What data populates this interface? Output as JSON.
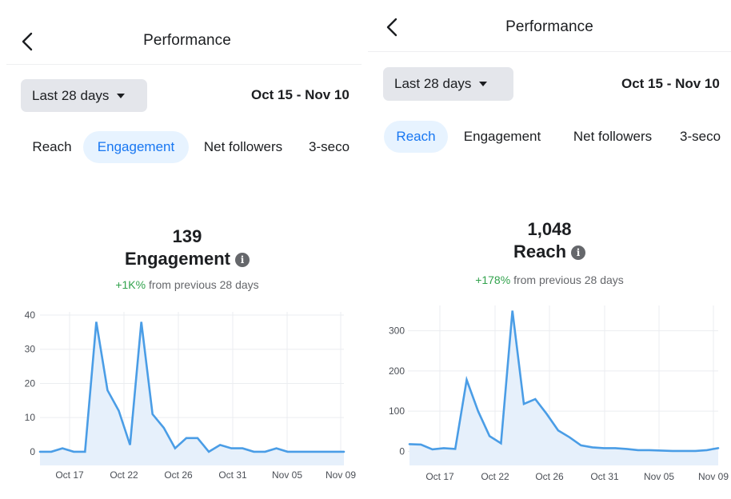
{
  "panels": [
    {
      "id": "left",
      "header": {
        "title": "Performance"
      },
      "range_button": {
        "label": "Last 28 days"
      },
      "date_range": "Oct 15 - Nov 10",
      "tabs": [
        {
          "label": "Reach",
          "active": false
        },
        {
          "label": "Engagement",
          "active": true
        },
        {
          "label": "Net followers",
          "active": false
        },
        {
          "label": "3-seco",
          "active": false
        }
      ],
      "metric": {
        "value": "139",
        "name": "Engagement",
        "change": "+1K%",
        "change_suffix": "from previous 28 days"
      }
    },
    {
      "id": "right",
      "header": {
        "title": "Performance"
      },
      "range_button": {
        "label": "Last 28 days"
      },
      "date_range": "Oct 15 - Nov 10",
      "tabs": [
        {
          "label": "Reach",
          "active": true
        },
        {
          "label": "Engagement",
          "active": false
        },
        {
          "label": "Net followers",
          "active": false
        },
        {
          "label": "3-seco",
          "active": false
        }
      ],
      "metric": {
        "value": "1,048",
        "name": "Reach",
        "change": "+178%",
        "change_suffix": "from previous 28 days"
      }
    }
  ],
  "colors": {
    "accent": "#1877f2",
    "line": "#4a9de6",
    "fill": "#e6f0fb",
    "positive": "#31a24c",
    "tab_active_bg": "#e7f3ff",
    "button_bg": "#e4e6eb"
  },
  "chart_data": [
    {
      "type": "area",
      "title": "",
      "xlabel": "",
      "ylabel": "",
      "x_tick_labels": [
        "Oct 17",
        "Oct 22",
        "Oct 26",
        "Oct 31",
        "Nov 05",
        "Nov 09"
      ],
      "y_ticks": [
        0,
        10,
        20,
        30,
        40
      ],
      "ylim": [
        -4,
        40
      ],
      "grid": true,
      "series": [
        {
          "values": [
            0,
            0,
            1,
            0,
            0,
            38,
            18,
            12,
            2,
            38,
            11,
            7,
            1,
            4,
            4,
            0,
            2,
            1,
            1,
            0,
            0,
            1,
            0,
            0,
            0,
            0,
            0,
            0
          ]
        }
      ]
    },
    {
      "type": "area",
      "title": "",
      "xlabel": "",
      "ylabel": "",
      "x_tick_labels": [
        "Oct 17",
        "Oct 22",
        "Oct 26",
        "Oct 31",
        "Nov 05",
        "Nov 09"
      ],
      "y_ticks": [
        0,
        100,
        200,
        300
      ],
      "ylim": [
        -35,
        355
      ],
      "grid": true,
      "series": [
        {
          "values": [
            18,
            17,
            5,
            8,
            6,
            178,
            100,
            38,
            20,
            350,
            118,
            130,
            93,
            52,
            35,
            15,
            10,
            8,
            8,
            6,
            3,
            3,
            2,
            1,
            1,
            1,
            3,
            8
          ]
        }
      ]
    }
  ]
}
